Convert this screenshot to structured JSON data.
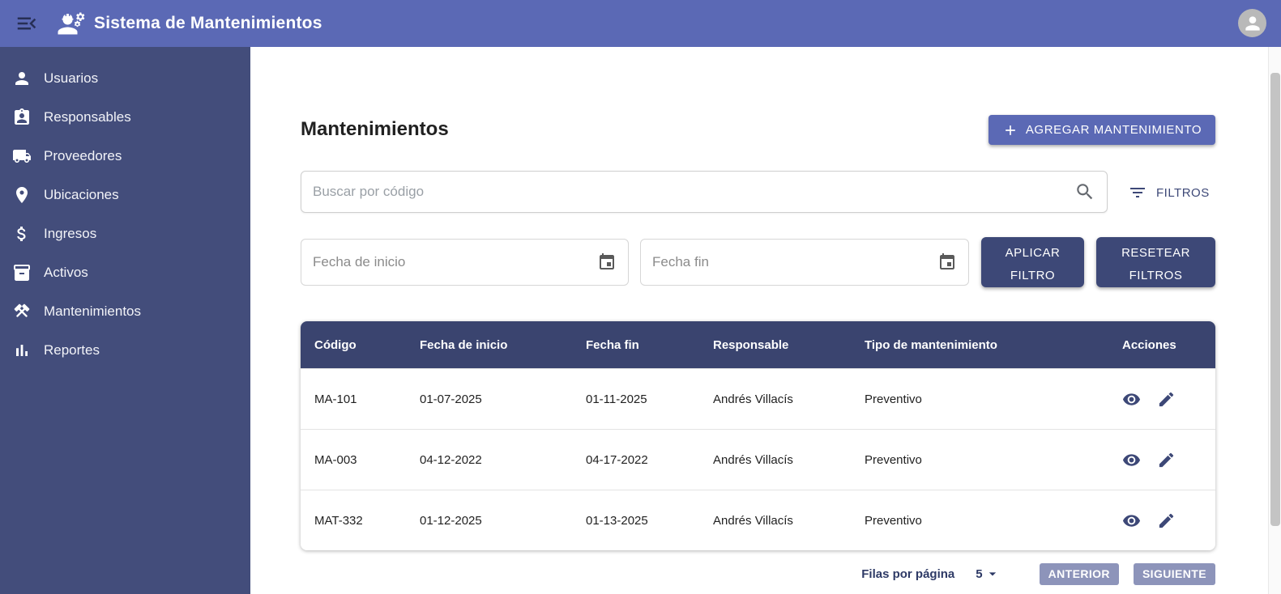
{
  "app": {
    "title": "Sistema de Mantenimientos"
  },
  "sidebar": {
    "items": [
      {
        "icon": "person-icon",
        "label": "Usuarios"
      },
      {
        "icon": "assignment-ind-icon",
        "label": "Responsables"
      },
      {
        "icon": "truck-icon",
        "label": "Proveedores"
      },
      {
        "icon": "location-pin-icon",
        "label": "Ubicaciones"
      },
      {
        "icon": "dollar-icon",
        "label": "Ingresos"
      },
      {
        "icon": "inventory-icon",
        "label": "Activos"
      },
      {
        "icon": "crossed-tools-icon",
        "label": "Mantenimientos"
      },
      {
        "icon": "bar-chart-icon",
        "label": "Reportes"
      }
    ]
  },
  "main": {
    "page_title": "Mantenimientos",
    "add_button_label": "AGREGAR MANTENIMIENTO",
    "search": {
      "placeholder": "Buscar por código"
    },
    "filters_label": "FILTROS",
    "date_filters": {
      "start_placeholder": "Fecha de inicio",
      "end_placeholder": "Fecha fin",
      "apply_label": "APLICAR FILTRO",
      "reset_label": "RESETEAR FILTROS"
    },
    "table": {
      "columns": [
        "Código",
        "Fecha de inicio",
        "Fecha fin",
        "Responsable",
        "Tipo de mantenimiento",
        "Acciones"
      ],
      "rows": [
        {
          "codigo": "MA-101",
          "fecha_inicio": "01-07-2025",
          "fecha_fin": "01-11-2025",
          "responsable": "Andrés Villacís",
          "tipo": "Preventivo"
        },
        {
          "codigo": "MA-003",
          "fecha_inicio": "04-12-2022",
          "fecha_fin": "04-17-2022",
          "responsable": "Andrés Villacís",
          "tipo": "Preventivo"
        },
        {
          "codigo": "MAT-332",
          "fecha_inicio": "01-12-2025",
          "fecha_fin": "01-13-2025",
          "responsable": "Andrés Villacís",
          "tipo": "Preventivo"
        }
      ]
    },
    "pagination": {
      "rows_per_page_label": "Filas por página",
      "rows_per_page_value": "5",
      "prev_label": "ANTERIOR",
      "next_label": "SIGUIENTE"
    }
  },
  "colors": {
    "header_bg": "#5b69b5",
    "sidebar_bg": "#434d7b",
    "table_header_bg": "#3a446f",
    "navy_button_bg": "#3d4877",
    "accent_button_bg": "#5b69b5",
    "muted_page_button_bg": "#8d94ba",
    "pagination_text": "#2e3a66",
    "row_text": "#1f1f1f"
  }
}
